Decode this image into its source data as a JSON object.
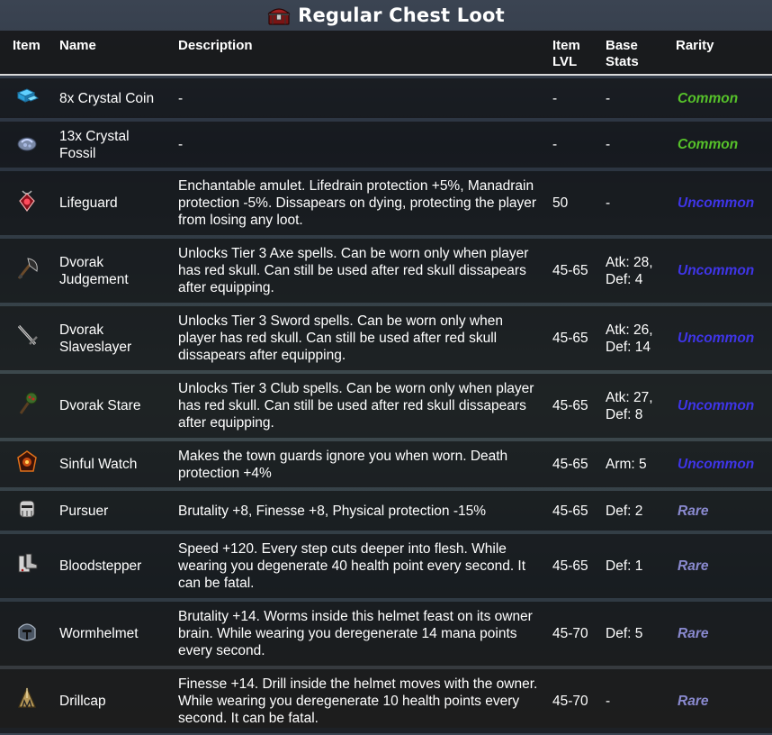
{
  "title": "Regular Chest Loot",
  "header": {
    "item": "Item",
    "name": "Name",
    "description": "Description",
    "item_lvl": "Item LVL",
    "base_stats": "Base Stats",
    "rarity": "Rarity"
  },
  "colors": {
    "common": "#56c12a",
    "uncommon": "#3f35e8",
    "rare": "#8a8ad0"
  },
  "rows": [
    {
      "icon": "crystal-coin-icon",
      "name": "8x Crystal Coin",
      "description": "-",
      "lvl": "-",
      "stats": "-",
      "rarity": "Common"
    },
    {
      "icon": "crystal-fossil-icon",
      "name": "13x Crystal Fossil",
      "description": "-",
      "lvl": "-",
      "stats": "-",
      "rarity": "Common"
    },
    {
      "icon": "lifeguard-amulet-icon",
      "name": "Lifeguard",
      "description": "Enchantable amulet. Lifedrain protection +5%, Manadrain protection -5%. Dissapears on dying, protecting the player from losing any loot.",
      "lvl": "50",
      "stats": "-",
      "rarity": "Uncommon"
    },
    {
      "icon": "axe-icon",
      "name": "Dvorak Judgement",
      "description": "Unlocks Tier 3 Axe spells. Can be worn only when player has red skull. Can still be used after red skull dissapears after equipping.",
      "lvl": "45-65",
      "stats": "Atk: 28, Def: 4",
      "rarity": "Uncommon"
    },
    {
      "icon": "sword-icon",
      "name": "Dvorak Slaveslayer",
      "description": "Unlocks Tier 3 Sword spells. Can be worn only when player has red skull. Can still be used after red skull dissapears after equipping.",
      "lvl": "45-65",
      "stats": "Atk: 26, Def: 14",
      "rarity": "Uncommon"
    },
    {
      "icon": "club-icon",
      "name": "Dvorak Stare",
      "description": "Unlocks Tier 3 Club spells. Can be worn only when player has red skull. Can still be used after red skull dissapears after equipping.",
      "lvl": "45-65",
      "stats": "Atk: 27, Def: 8",
      "rarity": "Uncommon"
    },
    {
      "icon": "sinful-watch-icon",
      "name": "Sinful Watch",
      "description": "Makes the town guards ignore you when worn. Death protection +4%",
      "lvl": "45-65",
      "stats": "Arm: 5",
      "rarity": "Uncommon"
    },
    {
      "icon": "pursuer-icon",
      "name": "Pursuer",
      "description": "Brutality +8, Finesse +8, Physical protection -15%",
      "lvl": "45-65",
      "stats": "Def: 2",
      "rarity": "Rare"
    },
    {
      "icon": "bloodstepper-boots-icon",
      "name": "Bloodstepper",
      "description": "Speed +120. Every step cuts deeper into flesh. While wearing you degenerate 40 health point every second. It can be fatal.",
      "lvl": "45-65",
      "stats": "Def: 1",
      "rarity": "Rare"
    },
    {
      "icon": "wormhelmet-icon",
      "name": "Wormhelmet",
      "description": "Brutality +14. Worms inside this helmet feast on its owner brain. While wearing you deregenerate 14 mana points every second.",
      "lvl": "45-70",
      "stats": "Def: 5",
      "rarity": "Rare"
    },
    {
      "icon": "drillcap-icon",
      "name": "Drillcap",
      "description": "Finesse +14. Drill inside the helmet moves with the owner. While wearing you deregenerate 10 health points every second. It can be fatal.",
      "lvl": "45-70",
      "stats": "-",
      "rarity": "Rare"
    }
  ]
}
